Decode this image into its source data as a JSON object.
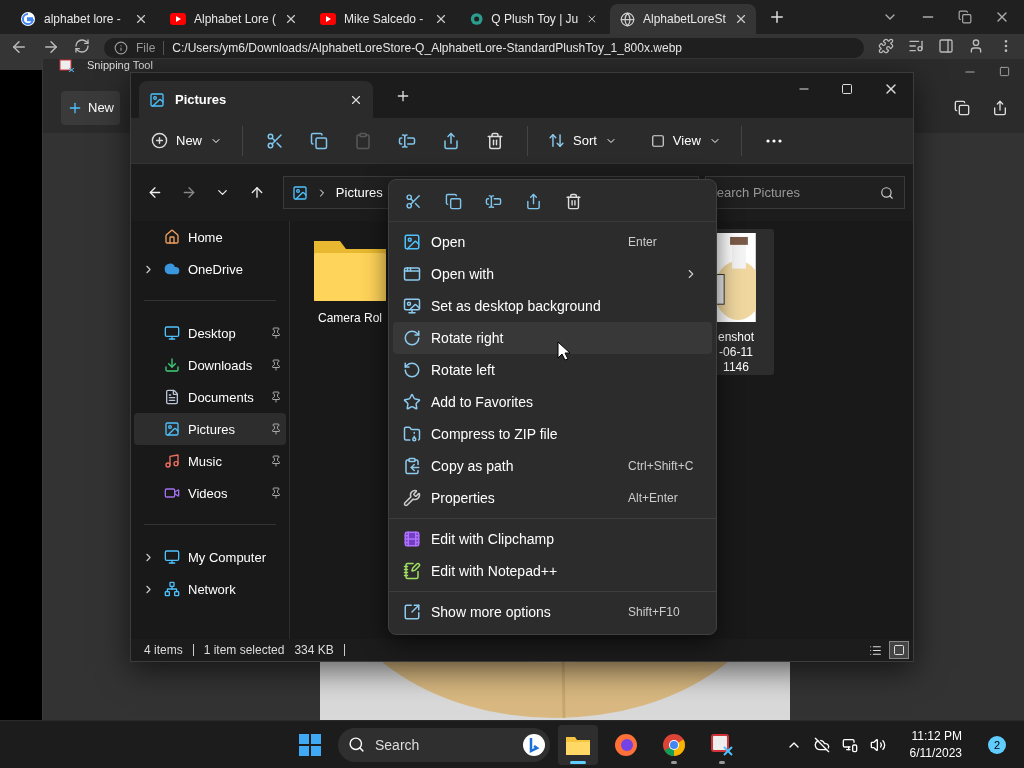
{
  "browser": {
    "tabs": [
      {
        "kind": "google",
        "title": "alphabet lore -",
        "selected": false
      },
      {
        "kind": "youtube",
        "title": "Alphabet Lore (",
        "selected": false
      },
      {
        "kind": "youtube",
        "title": "Mike Salcedo -",
        "selected": false
      },
      {
        "kind": "shop",
        "title": "Q Plush Toy | Ju",
        "selected": false
      },
      {
        "kind": "globe",
        "title": "AlphabetLoreSt",
        "selected": true
      }
    ],
    "address": {
      "scheme": "File",
      "url": "C:/Users/ym6/Downloads/AlphabetLoreStore-Q_AlphabetLore-StandardPlushToy_1_800x.webp"
    }
  },
  "snipping_tool": {
    "title": "Snipping Tool",
    "new_button": "New"
  },
  "explorer": {
    "tab": "Pictures",
    "toolbar": {
      "new": "New",
      "actions": [
        {
          "kind": "cut",
          "disabled": false
        },
        {
          "kind": "copy",
          "disabled": false
        },
        {
          "kind": "paste",
          "disabled": true
        },
        {
          "kind": "rename",
          "disabled": false
        },
        {
          "kind": "share",
          "disabled": false
        },
        {
          "kind": "delete",
          "disabled": false
        }
      ],
      "sort": "Sort",
      "view": "View"
    },
    "address": {
      "crumb": "Pictures"
    },
    "search": {
      "placeholder": "earch Pictures"
    },
    "sidebar": [
      {
        "kind": "home",
        "label": "Home",
        "expandable": false,
        "pinned": false,
        "selected": false
      },
      {
        "kind": "cloud",
        "label": "OneDrive",
        "expandable": true,
        "pinned": false,
        "selected": false
      },
      {
        "kind": "separator"
      },
      {
        "kind": "desktop",
        "label": "Desktop",
        "expandable": false,
        "pinned": true,
        "selected": false
      },
      {
        "kind": "downloads",
        "label": "Downloads",
        "expandable": false,
        "pinned": true,
        "selected": false
      },
      {
        "kind": "documents",
        "label": "Documents",
        "expandable": false,
        "pinned": true,
        "selected": false
      },
      {
        "kind": "pictures",
        "label": "Pictures",
        "expandable": false,
        "pinned": true,
        "selected": true
      },
      {
        "kind": "music",
        "label": "Music",
        "expandable": false,
        "pinned": true,
        "selected": false
      },
      {
        "kind": "videos",
        "label": "Videos",
        "expandable": false,
        "pinned": true,
        "selected": false
      },
      {
        "kind": "separator"
      },
      {
        "kind": "computer",
        "label": "My Computer",
        "expandable": true,
        "pinned": false,
        "selected": false
      },
      {
        "kind": "network",
        "label": "Network",
        "expandable": true,
        "pinned": false,
        "selected": false
      }
    ],
    "files": [
      {
        "kind": "folder",
        "lines": [
          "Camera Rol"
        ],
        "selected": false
      },
      {
        "lines": [
          "enshot",
          "-06-11",
          "1146"
        ],
        "selected": true
      }
    ],
    "status_bar": {
      "count": "4 items",
      "selection": "1 item selected",
      "size": "334 KB",
      "views": [
        {
          "kind": "details",
          "selected": false
        },
        {
          "kind": "tiles",
          "selected": true
        }
      ]
    }
  },
  "context_menu": {
    "quick_actions": [
      {
        "kind": "cut"
      },
      {
        "kind": "copy"
      },
      {
        "kind": "rename"
      },
      {
        "kind": "share"
      },
      {
        "kind": "delete"
      }
    ],
    "items": [
      {
        "kind": "open",
        "label": "Open",
        "shortcut": "Enter",
        "submenu": false,
        "highlighted": false
      },
      {
        "kind": "openwith",
        "label": "Open with",
        "submenu": true,
        "highlighted": false
      },
      {
        "kind": "wallpaper",
        "label": "Set as desktop background",
        "submenu": false,
        "highlighted": false
      },
      {
        "kind": "rotateright",
        "label": "Rotate right",
        "submenu": false,
        "highlighted": true
      },
      {
        "kind": "rotateleft",
        "label": "Rotate left",
        "submenu": false,
        "highlighted": false
      },
      {
        "kind": "favorite",
        "label": "Add to Favorites",
        "submenu": false,
        "highlighted": false
      },
      {
        "kind": "zip",
        "label": "Compress to ZIP file",
        "submenu": false,
        "highlighted": false
      },
      {
        "kind": "path",
        "label": "Copy as path",
        "shortcut": "Ctrl+Shift+C",
        "submenu": false,
        "highlighted": false
      },
      {
        "kind": "properties",
        "label": "Properties",
        "shortcut": "Alt+Enter",
        "submenu": false,
        "highlighted": false
      },
      {
        "kind": "separator"
      },
      {
        "kind": "clipchamp",
        "label": "Edit with Clipchamp",
        "submenu": false,
        "highlighted": false
      },
      {
        "kind": "notepad",
        "label": "Edit with Notepad++",
        "submenu": false,
        "highlighted": false
      },
      {
        "kind": "separator"
      },
      {
        "kind": "more",
        "label": "Show more options",
        "shortcut": "Shift+F10",
        "submenu": false,
        "highlighted": false
      }
    ]
  },
  "taskbar": {
    "search": {
      "placeholder": "Search"
    },
    "apps": [
      {
        "kind": "explorer",
        "running": true,
        "active": true
      },
      {
        "kind": "firefox",
        "running": false,
        "active": false
      },
      {
        "kind": "chrome",
        "running": true,
        "active": false
      },
      {
        "kind": "snipping",
        "running": true,
        "active": false
      }
    ],
    "time": "11:12 PM",
    "date": "6/11/2023",
    "notifications": "2"
  }
}
